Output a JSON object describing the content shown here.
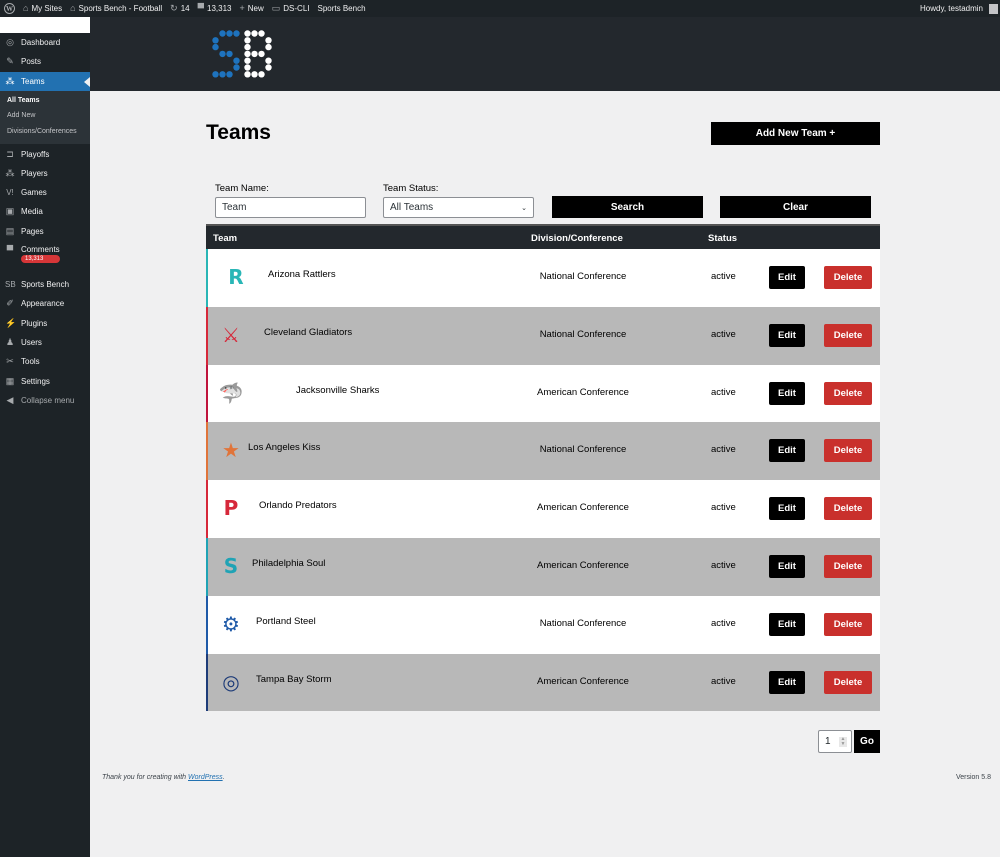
{
  "admin_bar": {
    "wp_logo": "W",
    "my_sites": "My Sites",
    "site_name": "Sports Bench - Football",
    "updates_count": "14",
    "comments_count": "13,313",
    "new_label": "New",
    "dscli_label": "DS-CLI",
    "sports_bench_label": "Sports Bench",
    "howdy": "Howdy, testadmin"
  },
  "sidebar": {
    "items": [
      {
        "label": "Dashboard",
        "icon": "dashboard-icon",
        "glyph": "◎"
      },
      {
        "label": "Posts",
        "icon": "pin-icon",
        "glyph": "✎"
      },
      {
        "label": "Teams",
        "icon": "groups-icon",
        "glyph": "⁂"
      }
    ],
    "submenu": [
      "All Teams",
      "Add New",
      "Divisions/Conferences"
    ],
    "items2": [
      {
        "label": "Playoffs",
        "icon": "bracket-icon",
        "glyph": "⊐"
      },
      {
        "label": "Players",
        "icon": "players-icon",
        "glyph": "⁂"
      },
      {
        "label": "Games",
        "icon": "games-icon",
        "glyph": "V!"
      },
      {
        "label": "Media",
        "icon": "media-icon",
        "glyph": "▣"
      },
      {
        "label": "Pages",
        "icon": "pages-icon",
        "glyph": "▤"
      }
    ],
    "comments": {
      "label": "Comments",
      "badge": "13,313"
    },
    "items3": [
      {
        "label": "Sports Bench",
        "icon": "sb-icon",
        "glyph": "SB"
      },
      {
        "label": "Appearance",
        "icon": "brush-icon",
        "glyph": "✐"
      },
      {
        "label": "Plugins",
        "icon": "plugin-icon",
        "glyph": "⚡"
      },
      {
        "label": "Users",
        "icon": "user-icon",
        "glyph": "♟"
      },
      {
        "label": "Tools",
        "icon": "wrench-icon",
        "glyph": "✂"
      },
      {
        "label": "Settings",
        "icon": "settings-icon",
        "glyph": "▦"
      }
    ],
    "collapse": "Collapse menu"
  },
  "page": {
    "title": "Teams",
    "add_new_label": "Add New Team +",
    "filters": {
      "team_name_label": "Team Name:",
      "team_name_value": "Team",
      "team_status_label": "Team Status:",
      "team_status_value": "All Teams",
      "search_label": "Search",
      "clear_label": "Clear"
    },
    "table": {
      "headers": {
        "team": "Team",
        "division": "Division/Conference",
        "status": "Status"
      },
      "edit_label": "Edit",
      "delete_label": "Delete",
      "rows": [
        {
          "name": "Arizona Rattlers",
          "division": "National Conference",
          "status": "active",
          "accent": "#29b6b6"
        },
        {
          "name": "Cleveland Gladiators",
          "division": "National Conference",
          "status": "active",
          "accent": "#d6283a"
        },
        {
          "name": "Jacksonville Sharks",
          "division": "American Conference",
          "status": "active",
          "accent": "#c0143c"
        },
        {
          "name": "Los Angeles Kiss",
          "division": "National Conference",
          "status": "active",
          "accent": "#e0743a"
        },
        {
          "name": "Orlando Predators",
          "division": "American Conference",
          "status": "active",
          "accent": "#d6283a"
        },
        {
          "name": "Philadelphia Soul",
          "division": "American Conference",
          "status": "active",
          "accent": "#1fa3b5"
        },
        {
          "name": "Portland Steel",
          "division": "National Conference",
          "status": "active",
          "accent": "#1f5aa8"
        },
        {
          "name": "Tampa Bay Storm",
          "division": "American Conference",
          "status": "active",
          "accent": "#1d3b78"
        }
      ]
    },
    "pagination": {
      "page": "1",
      "go_label": "Go"
    }
  },
  "footer": {
    "thanks_prefix": "Thank you for creating with ",
    "wordpress_link": "WordPress",
    "thanks_suffix": ".",
    "version": "Version 5.8"
  },
  "colors": {
    "accent": "#2271b1",
    "delete": "#c9302c",
    "header_bg": "#23282d"
  }
}
